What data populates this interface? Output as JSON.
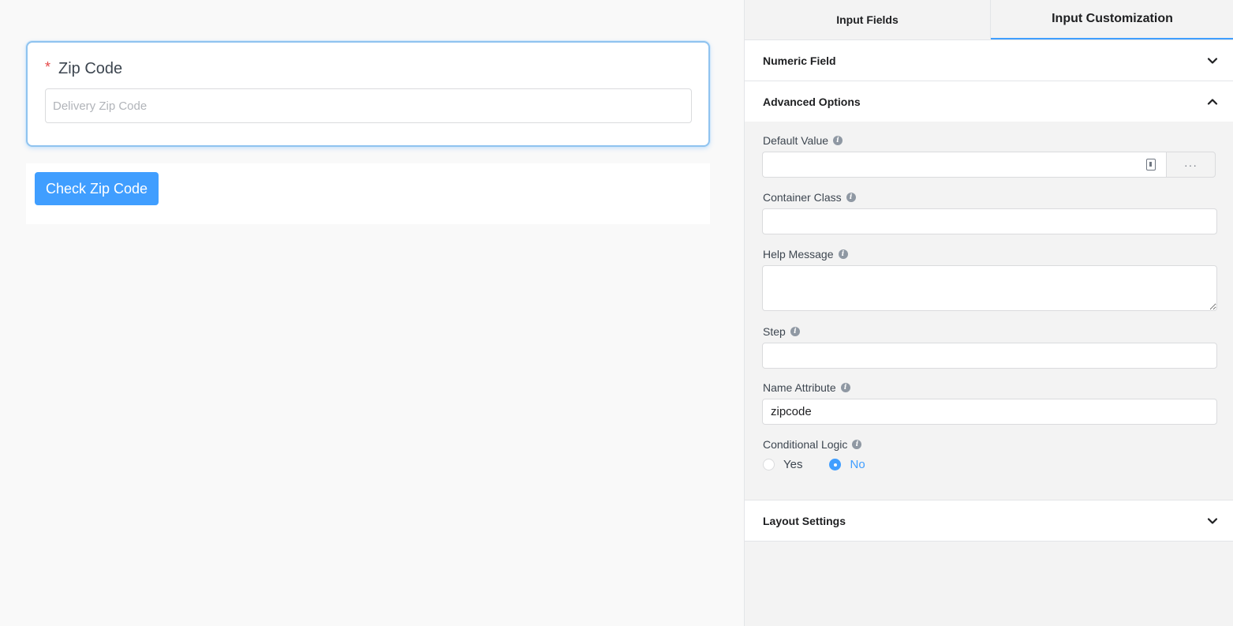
{
  "editor": {
    "field_label": "Zip Code",
    "required_mark": "*",
    "input_placeholder": "Delivery Zip Code",
    "submit_label": "Check Zip Code"
  },
  "sidebar": {
    "tabs": [
      {
        "label": "Input Fields",
        "active": false
      },
      {
        "label": "Input Customization",
        "active": true
      }
    ],
    "sections": {
      "numeric": {
        "title": "Numeric Field",
        "expanded": false
      },
      "advanced": {
        "title": "Advanced Options",
        "expanded": true
      },
      "layout": {
        "title": "Layout Settings",
        "expanded": false
      }
    },
    "advanced": {
      "default_value": {
        "label": "Default Value",
        "value": "",
        "more_label": "···"
      },
      "container_class": {
        "label": "Container Class",
        "value": ""
      },
      "help_message": {
        "label": "Help Message",
        "value": ""
      },
      "step": {
        "label": "Step",
        "value": ""
      },
      "name_attribute": {
        "label": "Name Attribute",
        "value": "zipcode"
      },
      "conditional_logic": {
        "label": "Conditional Logic",
        "options": [
          "Yes",
          "No"
        ],
        "selected": "No"
      }
    },
    "info_glyph": "i"
  },
  "colors": {
    "accent": "#409eff",
    "required": "#e54848",
    "field_focus_border": "#8fc3ef"
  }
}
